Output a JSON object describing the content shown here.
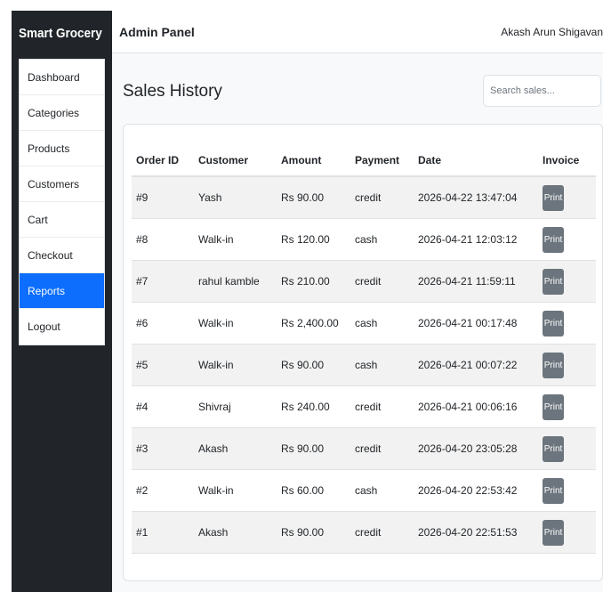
{
  "sidebar": {
    "brand": "Smart Grocery",
    "items": [
      {
        "label": "Dashboard",
        "active": false
      },
      {
        "label": "Categories",
        "active": false
      },
      {
        "label": "Products",
        "active": false
      },
      {
        "label": "Customers",
        "active": false
      },
      {
        "label": "Cart",
        "active": false
      },
      {
        "label": "Checkout",
        "active": false
      },
      {
        "label": "Reports",
        "active": true
      },
      {
        "label": "Logout",
        "active": false
      }
    ]
  },
  "header": {
    "title": "Admin Panel",
    "user": "Akash Arun Shigavan"
  },
  "main": {
    "page_title": "Sales History",
    "search_placeholder": "Search sales..."
  },
  "table": {
    "columns": [
      "Order ID",
      "Customer",
      "Amount",
      "Payment",
      "Date",
      "Invoice"
    ],
    "rows": [
      {
        "id": "#9",
        "customer": "Yash",
        "amount": "Rs 90.00",
        "payment": "credit",
        "date": "2026-04-22 13:47:04",
        "action": "Print"
      },
      {
        "id": "#8",
        "customer": "Walk-in",
        "amount": "Rs 120.00",
        "payment": "cash",
        "date": "2026-04-21 12:03:12",
        "action": "Print"
      },
      {
        "id": "#7",
        "customer": "rahul kamble",
        "amount": "Rs 210.00",
        "payment": "credit",
        "date": "2026-04-21 11:59:11",
        "action": "Print"
      },
      {
        "id": "#6",
        "customer": "Walk-in",
        "amount": "Rs 2,400.00",
        "payment": "cash",
        "date": "2026-04-21 00:17:48",
        "action": "Print"
      },
      {
        "id": "#5",
        "customer": "Walk-in",
        "amount": "Rs 90.00",
        "payment": "cash",
        "date": "2026-04-21 00:07:22",
        "action": "Print"
      },
      {
        "id": "#4",
        "customer": "Shivraj",
        "amount": "Rs 240.00",
        "payment": "credit",
        "date": "2026-04-21 00:06:16",
        "action": "Print"
      },
      {
        "id": "#3",
        "customer": "Akash",
        "amount": "Rs 90.00",
        "payment": "credit",
        "date": "2026-04-20 23:05:28",
        "action": "Print"
      },
      {
        "id": "#2",
        "customer": "Walk-in",
        "amount": "Rs 60.00",
        "payment": "cash",
        "date": "2026-04-20 22:53:42",
        "action": "Print"
      },
      {
        "id": "#1",
        "customer": "Akash",
        "amount": "Rs 90.00",
        "payment": "credit",
        "date": "2026-04-20 22:51:53",
        "action": "Print"
      }
    ]
  },
  "colors": {
    "sidebar_bg": "#212529",
    "active": "#0d6efd",
    "print_button": "#6c757d",
    "stripe": "#f2f2f2"
  }
}
